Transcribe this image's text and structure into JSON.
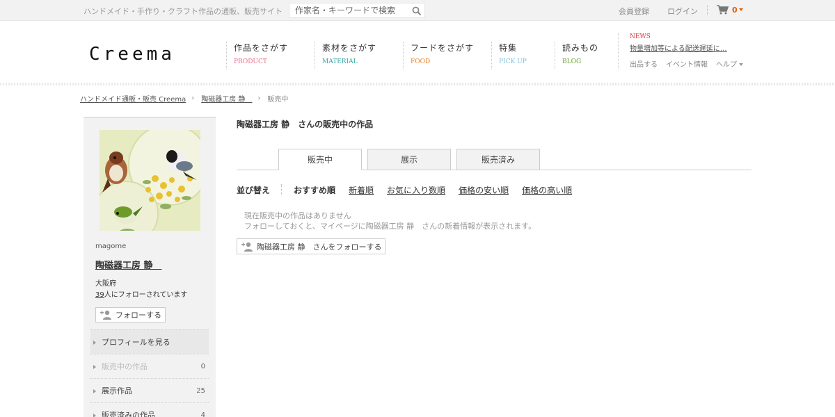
{
  "topbar": {
    "tagline": "ハンドメイド・手作り・クラフト作品の通販、販売サイト",
    "search_placeholder": "作家名・キーワードで検索",
    "register": "会員登録",
    "login": "ログイン",
    "cart_count": "0"
  },
  "header": {
    "logo": "Creema",
    "nav": [
      {
        "jp": "作品をさがす",
        "en": "PRODUCT",
        "color": "#e8708a"
      },
      {
        "jp": "素材をさがす",
        "en": "MATERIAL",
        "color": "#3aa6a0"
      },
      {
        "jp": "フードをさがす",
        "en": "FOOD",
        "color": "#e8822a"
      },
      {
        "jp": "特集",
        "en": "PICK UP",
        "color": "#7fc0dc"
      },
      {
        "jp": "読みもの",
        "en": "BLOG",
        "color": "#6aa030"
      }
    ],
    "news_label": "NEWS",
    "news_text": "物量増加等による配送遅延に…",
    "subnav": {
      "sell": "出品する",
      "events": "イベント情報",
      "help": "ヘルプ"
    }
  },
  "breadcrumb": {
    "home": "ハンドメイド通販・販売 Creema",
    "shop": "陶磁器工房 静　",
    "current": "販売中"
  },
  "sidebar": {
    "username": "magome",
    "shop_name": "陶磁器工房 静　",
    "region": "大阪府",
    "followers_count": "39",
    "followers_suffix": "人にフォローされています",
    "follow_label": "フォローする",
    "menu": [
      {
        "label": "プロフィールを見る",
        "count": ""
      },
      {
        "label": "販売中の作品",
        "count": "0"
      },
      {
        "label": "展示作品",
        "count": "25"
      },
      {
        "label": "販売済みの作品",
        "count": "4"
      }
    ]
  },
  "main": {
    "title": "陶磁器工房 静　さんの販売中の作品",
    "tabs": [
      "販売中",
      "展示",
      "販売済み"
    ],
    "sort_label": "並び替え",
    "sort_options": [
      "おすすめ順",
      "新着順",
      "お気に入り数順",
      "価格の安い順",
      "価格の高い順"
    ],
    "empty_line1": "現在販売中の作品はありません",
    "empty_line2": "フォローしておくと、マイページに陶磁器工房 静　さんの新着情報が表示されます。",
    "follow_label": "陶磁器工房 静　さんをフォローする"
  }
}
